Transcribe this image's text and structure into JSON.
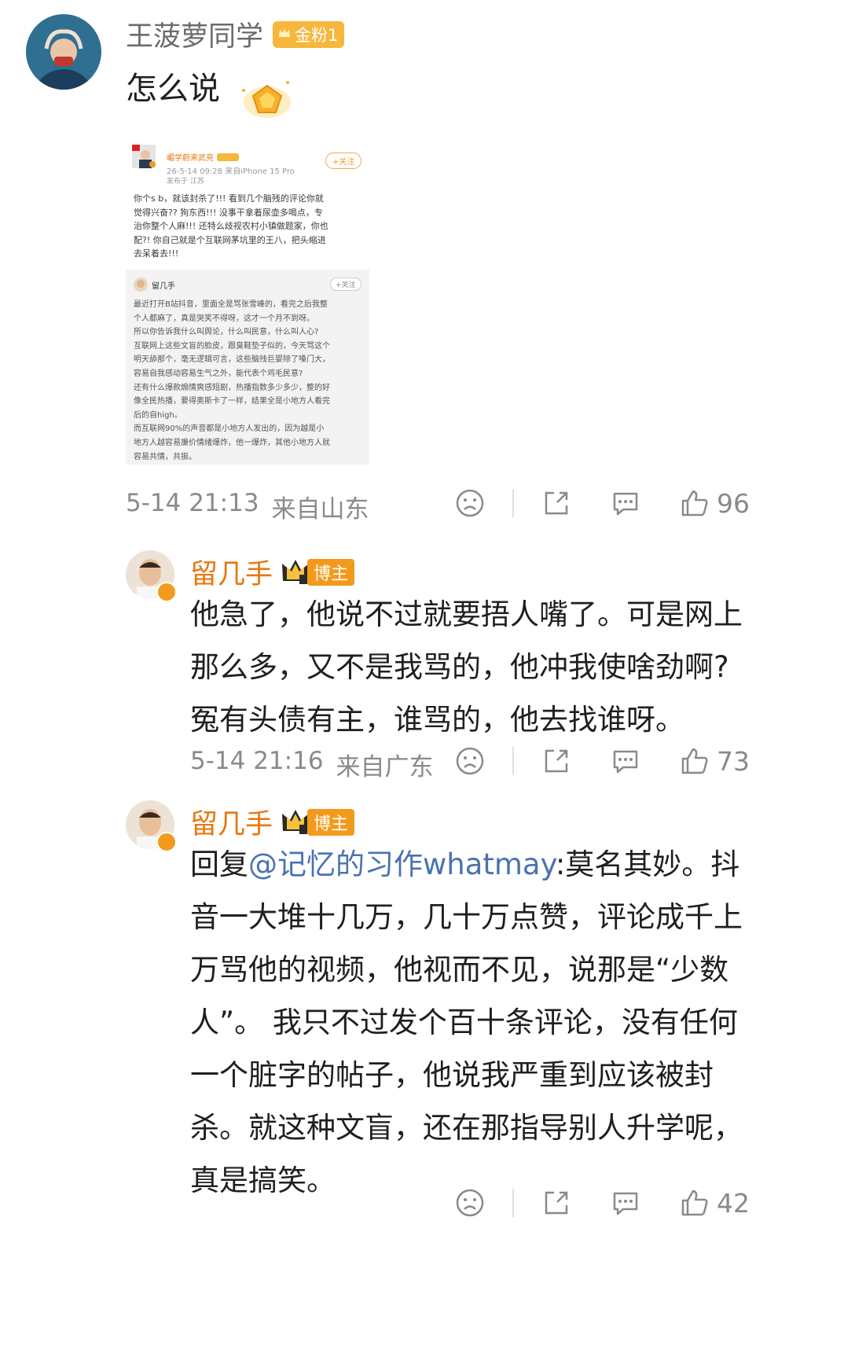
{
  "post": {
    "username": "王菠萝同学",
    "badge": "金粉1",
    "text": "怎么说",
    "time": "5-14 21:13",
    "location": "来自山东",
    "likes": "96",
    "embedded": {
      "top": {
        "name": "嵋学蔚来武亮",
        "meta": "26-5-14 09:28  来自iPhone 15 Pro",
        "region": "发布于 江苏",
        "follow": "+关注",
        "lines": [
          "你个s b，就该封杀了!!! 看到几个脑残的评论你就",
          "觉得兴奋?? 狗东西!!! 没事干拿着尿壶多喝点，专",
          "治你整个人麻!!! 还特么歧视农村小镇做题家，你也",
          "配?! 你自己就是个互联网茅坑里的王八，把头缩进",
          "去呆着去!!!"
        ]
      },
      "bottom": {
        "name": "留几手",
        "follow": "+关注",
        "lines": [
          "最近打开B站抖音，里面全是骂张雪峰的，看完之后我整",
          "个人都麻了，真是哭笑不得呀，这才一个月不到呀。",
          "所以你告诉我什么叫舆论，什么叫民意，什么叫人心?",
          "互联网上这些文盲的脸皮，跟臭鞋垫子似的，今天骂这个",
          "明天舔那个，毫无逻辑可言，这些脑残巨婴除了嗓门大，",
          "容易自我感动容易生气之外，能代表个鸡毛民意?",
          "还有什么爆款煽情爽感短剧，热播指数多少多少，整的好",
          "像全民热播，要得奥斯卡了一样，结果全是小地方人看完",
          "后的自high。",
          "而互联网90%的声音都是小地方人发出的，因为越是小",
          "地方人越容易廉价情绪爆炸，他一爆炸，其他小地方人就",
          "容易共情，共振。"
        ]
      }
    }
  },
  "replies": [
    {
      "username": "留几手",
      "badge": "博主",
      "lines": [
        "他急了，他说不过就要捂人嘴了。可是网上",
        "那么多，又不是我骂的，他冲我使啥劲啊?",
        "冤有头债有主，谁骂的，他去找谁呀。"
      ],
      "time": "5-14 21:16",
      "location": "来自广东",
      "likes": "73"
    },
    {
      "username": "留几手",
      "badge": "博主",
      "reply_prefix": "回复",
      "mention": "@记忆的习作whatmay",
      "line1_rest": ":莫名其妙。抖",
      "lines": [
        "音一大堆十几万，几十万点赞，评论成千上",
        "万骂他的视频，他视而不见，说那是“少数",
        "人”。 我只不过发个百十条评论，没有任何",
        "一个脏字的帖子，他说我严重到应该被封",
        "杀。就这种文盲，还在那指导别人升学呢，",
        "真是搞笑。"
      ],
      "likes": "42"
    }
  ],
  "icons": {
    "dislike": "sad-face-icon",
    "share": "share-icon",
    "comment": "comment-icon",
    "like": "thumbs-up-icon"
  },
  "colors": {
    "orange_name": "#e8770e",
    "mention_blue": "#4a72b0",
    "gold_badge": "#f6b73c"
  }
}
